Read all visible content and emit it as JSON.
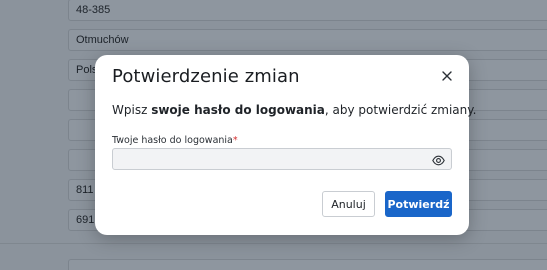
{
  "background_form": {
    "fields": [
      {
        "value": "48-385"
      },
      {
        "value": "Otmuchów"
      },
      {
        "value": "Pols"
      },
      {
        "value": ""
      },
      {
        "value": ""
      },
      {
        "value": ""
      },
      {
        "value": "811"
      },
      {
        "value": "691"
      },
      {
        "value": ""
      }
    ]
  },
  "modal": {
    "title": "Potwierdzenie zmian",
    "description_prefix": "Wpisz ",
    "description_bold": "swoje hasło do logowania",
    "description_suffix": ", aby potwierdzić zmiany.",
    "password_label": "Twoje hasło do logowania",
    "required_marker": "*",
    "password_value": "",
    "cancel_label": "Anuluj",
    "confirm_label": "Potwierdź"
  },
  "colors": {
    "accent": "#1a66c9",
    "required": "#d32f2f"
  },
  "icons": {
    "close": "close-icon",
    "password_visibility": "eye-icon"
  }
}
